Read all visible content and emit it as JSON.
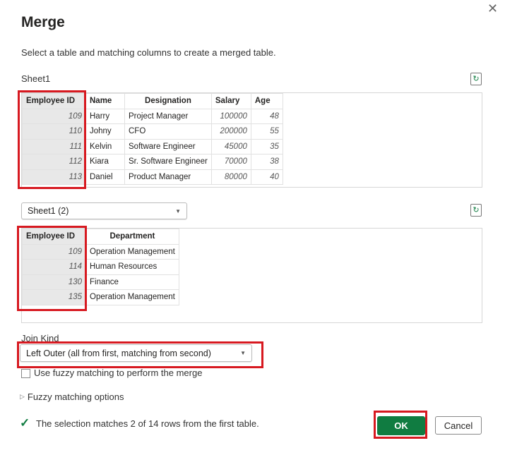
{
  "dialog": {
    "title": "Merge",
    "subtitle": "Select a table and matching columns to create a merged table.",
    "close_icon": "close-icon",
    "refresh_icon": "refresh-icon"
  },
  "table1": {
    "name": "Sheet1",
    "headers": [
      "Employee ID",
      "Name",
      "Designation",
      "Salary",
      "Age"
    ],
    "rows": [
      [
        "109",
        "Harry",
        "Project Manager",
        "100000",
        "48"
      ],
      [
        "110",
        "Johny",
        "CFO",
        "200000",
        "55"
      ],
      [
        "111",
        "Kelvin",
        "Software Engineer",
        "45000",
        "35"
      ],
      [
        "112",
        "Kiara",
        "Sr. Software Engineer",
        "70000",
        "38"
      ],
      [
        "113",
        "Daniel",
        "Product Manager",
        "80000",
        "40"
      ]
    ]
  },
  "table2": {
    "selected": "Sheet1 (2)",
    "headers": [
      "Employee ID",
      "Department"
    ],
    "rows": [
      [
        "109",
        "Operation Management"
      ],
      [
        "114",
        "Human Resources"
      ],
      [
        "130",
        "Finance"
      ],
      [
        "135",
        "Operation Management"
      ]
    ]
  },
  "join": {
    "label": "Join Kind",
    "selected": "Left Outer (all from first, matching from second)"
  },
  "fuzzy": {
    "checkbox_label": "Use fuzzy matching to perform the merge",
    "checked": false,
    "options_label": "Fuzzy matching options"
  },
  "status": {
    "text": "The selection matches 2 of 14 rows from the first table.",
    "color": "#107c41"
  },
  "buttons": {
    "ok": "OK",
    "cancel": "Cancel"
  },
  "highlight_color": "#d71920"
}
